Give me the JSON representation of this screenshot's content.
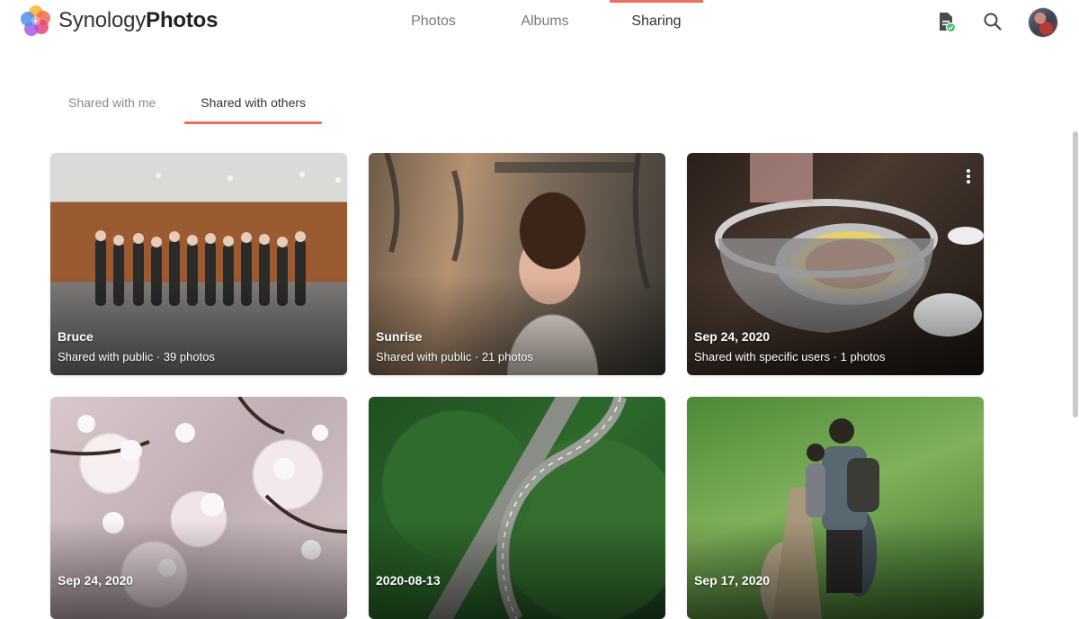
{
  "app": {
    "brand_light": "Synology",
    "brand_bold": "Photos",
    "accent_color": "#ea7062"
  },
  "nav": {
    "items": [
      {
        "label": "Photos",
        "active": false
      },
      {
        "label": "Albums",
        "active": false
      },
      {
        "label": "Sharing",
        "active": true
      }
    ]
  },
  "header_icons": [
    "task-file-icon",
    "search-icon",
    "user-avatar"
  ],
  "subtabs": [
    {
      "label": "Shared with me",
      "active": false
    },
    {
      "label": "Shared with others",
      "active": true
    }
  ],
  "albums": [
    {
      "title": "Bruce",
      "sharing": "Shared with public",
      "count": "39 photos"
    },
    {
      "title": "Sunrise",
      "sharing": "Shared with public",
      "count": "21 photos"
    },
    {
      "title": "Sep 24, 2020",
      "sharing": "Shared with specific users",
      "count": "1 photos"
    },
    {
      "title": "Sep 24, 2020",
      "sharing": "",
      "count": ""
    },
    {
      "title": "2020-08-13",
      "sharing": "",
      "count": ""
    },
    {
      "title": "Sep 17, 2020",
      "sharing": "",
      "count": ""
    }
  ],
  "separator": "·"
}
